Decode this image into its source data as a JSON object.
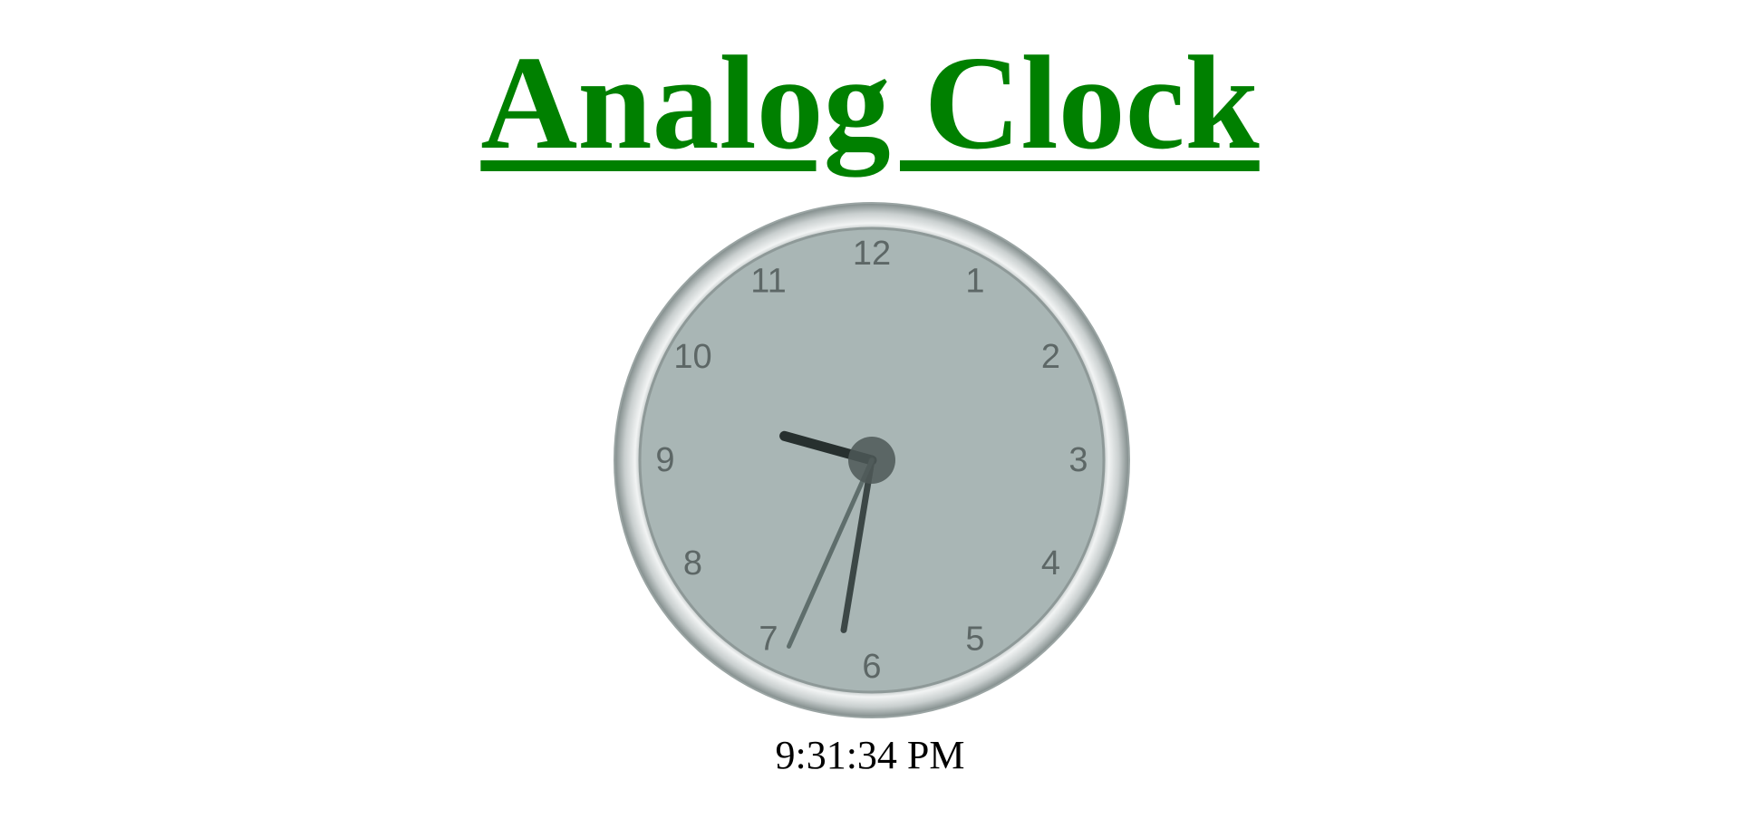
{
  "page": {
    "title": "Analog Clock"
  },
  "clock": {
    "numerals": [
      "12",
      "1",
      "2",
      "3",
      "4",
      "5",
      "6",
      "7",
      "8",
      "9",
      "10",
      "11"
    ],
    "time": {
      "hours": 9,
      "minutes": 31,
      "seconds": 34
    },
    "digital_time": "9:31:34 PM",
    "colors": {
      "face": "#a9b6b5",
      "bezel_light": "#e8ebeb",
      "bezel_dark": "#8e9998",
      "hour_hand": "#27302f",
      "minute_hand": "#3c4746",
      "second_hand": "#5f6e6c",
      "center_cap": "#4e5857",
      "numerals": "#5d6766"
    }
  }
}
